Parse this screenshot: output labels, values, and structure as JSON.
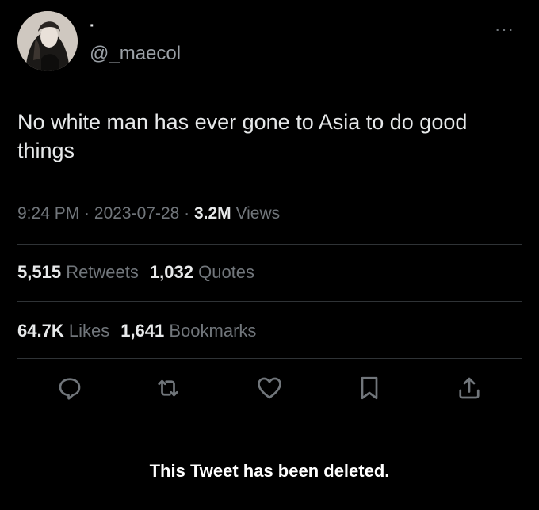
{
  "author": {
    "display_name": "·",
    "handle": "@_maecol"
  },
  "more_label": "···",
  "tweet": {
    "text": "No white man has ever gone to Asia to do good things"
  },
  "meta": {
    "time": "9:24 PM",
    "sep1": " · ",
    "date": "2023-07-28",
    "sep2": " · ",
    "views_count": "3.2M",
    "views_label": " Views"
  },
  "stats": {
    "retweets_count": "5,515",
    "retweets_label": "Retweets",
    "quotes_count": "1,032",
    "quotes_label": "Quotes",
    "likes_count": "64.7K",
    "likes_label": "Likes",
    "bookmarks_count": "1,641",
    "bookmarks_label": "Bookmarks"
  },
  "actions": [
    "reply-icon",
    "retweet-icon",
    "like-icon",
    "bookmark-icon",
    "share-icon"
  ],
  "deleted_notice": "This Tweet has been deleted.",
  "colors": {
    "background": "#000000",
    "text": "#e7e9ea",
    "secondary": "#71767b",
    "divider": "#2f3336"
  }
}
